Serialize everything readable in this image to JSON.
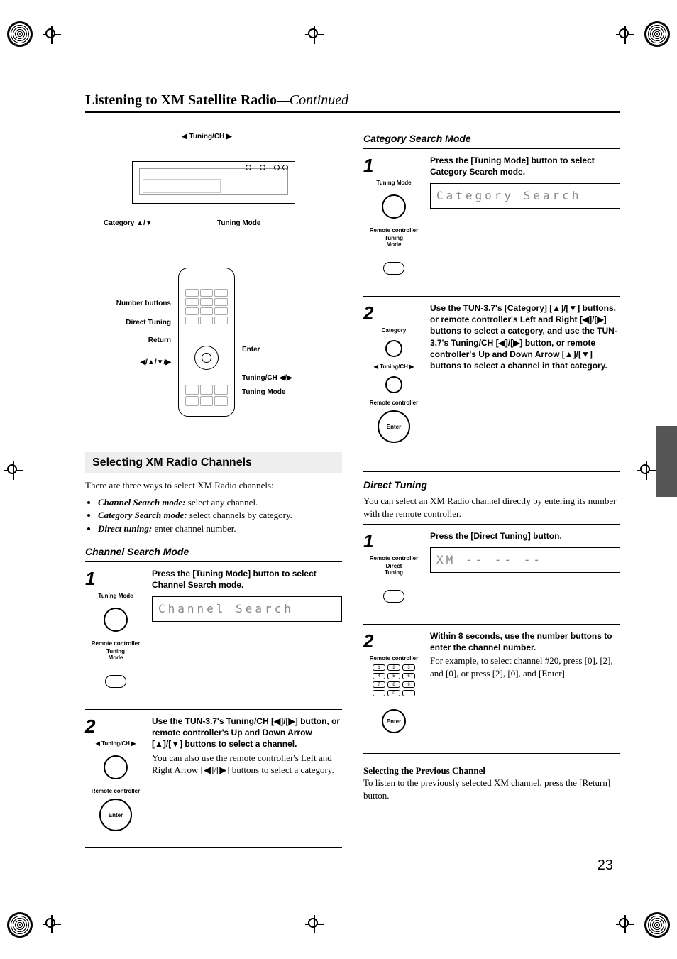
{
  "header": {
    "title": "Listening to XM Satellite Radio",
    "continued": "—Continued"
  },
  "diagram_device": {
    "callouts": {
      "tuning_ch_top": "◀ Tuning/CH ▶",
      "category": "Category ▲/▼",
      "tuning_mode": "Tuning Mode"
    }
  },
  "diagram_remote": {
    "callouts": {
      "number_buttons": "Number buttons",
      "direct_tuning": "Direct Tuning",
      "return": "Return",
      "arrows": "◀/▲/▼/▶",
      "enter": "Enter",
      "tuning_ch": "Tuning/CH ◀/▶",
      "tuning_mode": "Tuning Mode"
    }
  },
  "section_selecting": {
    "title": "Selecting XM Radio Channels",
    "intro": "There are three ways to select XM Radio channels:",
    "bullets": [
      {
        "em": "Channel Search mode:",
        "text": " select any channel."
      },
      {
        "em": "Category Search mode:",
        "text": " select channels by category."
      },
      {
        "em": "Direct tuning:",
        "text": " enter channel number."
      }
    ]
  },
  "channel_search": {
    "heading": "Channel Search Mode",
    "steps": [
      {
        "num": "1",
        "icon_top_label": "Tuning Mode",
        "rc_label": "Remote controller",
        "rc_sub": "Tuning\nMode",
        "text_bold": "Press the [Tuning Mode] button to select Channel Search mode.",
        "lcd": "Channel  Search"
      },
      {
        "num": "2",
        "icon_top_label": "◀ Tuning/CH ▶",
        "rc_label": "Remote controller",
        "text_bold": "Use the TUN-3.7's Tuning/CH [◀]/[▶] button, or remote controller's Up and Down Arrow [▲]/[▼] buttons to select a channel.",
        "text_plain": "You can also use the remote controller's Left and Right Arrow [◀]/[▶] buttons to select a category."
      }
    ]
  },
  "category_search": {
    "heading": "Category Search Mode",
    "steps": [
      {
        "num": "1",
        "icon_top_label": "Tuning Mode",
        "rc_label": "Remote controller",
        "rc_sub": "Tuning\nMode",
        "text_bold": "Press the [Tuning Mode] button to select Category Search mode.",
        "lcd": "Category Search"
      },
      {
        "num": "2",
        "icon_top_label": "Category",
        "icon_mid_label": "◀ Tuning/CH ▶",
        "rc_label": "Remote controller",
        "text_bold": "Use the TUN-3.7's [Category] [▲]/[▼] buttons, or remote controller's Left and Right [◀]/[▶] buttons to select a category, and use the TUN-3.7's Tuning/CH [◀]/[▶] button, or remote controller's Up and Down Arrow [▲]/[▼] buttons to select a channel in that category."
      }
    ]
  },
  "direct_tuning": {
    "heading": "Direct Tuning",
    "intro": "You can select an XM Radio channel directly by entering its number with the remote controller.",
    "steps": [
      {
        "num": "1",
        "rc_label": "Remote controller",
        "rc_sub": "Direct\nTuning",
        "text_bold": "Press the [Direct Tuning] button.",
        "lcd": "XM           -- -- --"
      },
      {
        "num": "2",
        "rc_label": "Remote controller",
        "text_bold": "Within 8 seconds, use the number buttons to enter the channel number.",
        "text_plain": "For example, to select channel #20, press [0], [2], and [0], or press [2], [0], and [Enter]."
      }
    ]
  },
  "previous_channel": {
    "heading": "Selecting the Previous Channel",
    "text": "To listen to the previously selected XM channel, press the [Return] button."
  },
  "page_number": "23"
}
